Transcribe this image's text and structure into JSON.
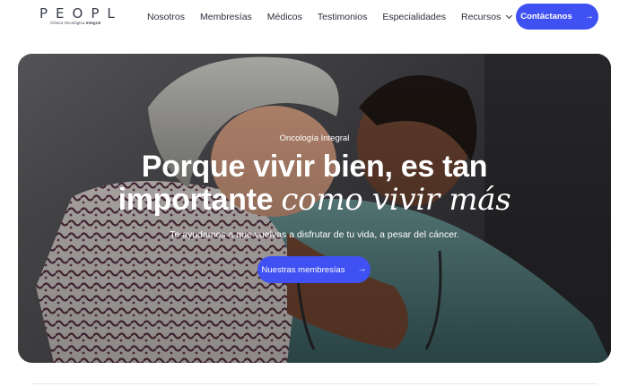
{
  "brand": {
    "logo_text": "PEOPL",
    "logo_sub_regular": "Clínica Oncológica",
    "logo_sub_bold": "Integral"
  },
  "nav": {
    "items": [
      "Nosotros",
      "Membresías",
      "Médicos",
      "Testimonios",
      "Especialidades"
    ],
    "resources_label": "Recursos",
    "cta_label": "Contáctanos"
  },
  "hero": {
    "eyebrow": "Oncología Integral",
    "headline_line1": "Porque vivir bien, es tan",
    "headline_line2_regular": "importante",
    "headline_line2_italic": "como vivir más",
    "subtitle": "Te ayudamos a que vuelvas a disfrutar de tu vida, a pesar del cáncer.",
    "button_label": "Nuestras membresías"
  },
  "icons": {
    "cta_arrow": "arrow-right-icon",
    "button_arrow": "arrow-right-icon",
    "resources_chevron": "chevron-down-icon"
  },
  "colors": {
    "accent": "#3f51f2",
    "text_dark": "#2b2f3c",
    "hero_text": "#ffffff"
  }
}
